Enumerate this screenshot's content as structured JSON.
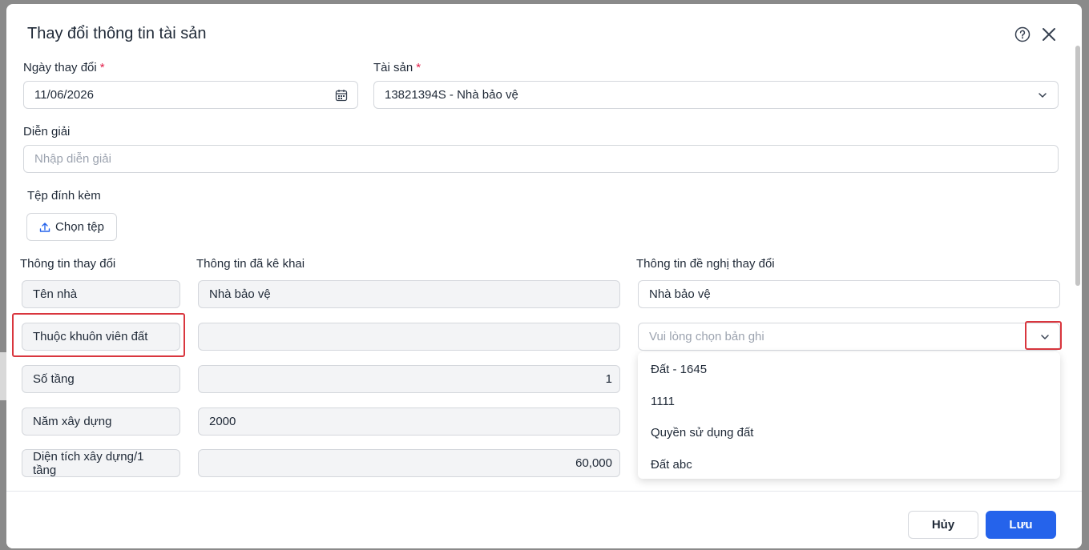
{
  "dialog": {
    "title": "Thay đổi thông tin tài sản"
  },
  "form": {
    "change_date": {
      "label": "Ngày thay đổi",
      "required_mark": "*",
      "value": "11/06/2026"
    },
    "asset": {
      "label": "Tài sản",
      "required_mark": "*",
      "value": "13821394S - Nhà bảo vệ"
    },
    "description": {
      "label": "Diễn giải",
      "placeholder": "Nhập diễn giải"
    },
    "attachment": {
      "label": "Tệp đính kèm",
      "button_label": "Chọn tệp"
    }
  },
  "change_table": {
    "headers": [
      "Thông tin thay đổi",
      "Thông tin đã kê khai",
      "Thông tin đề nghị thay đổi"
    ],
    "rows": [
      {
        "field": "Tên nhà",
        "declared": "Nhà bảo vệ",
        "proposed": "Nhà bảo vệ"
      },
      {
        "field": "Thuộc khuôn viên đất",
        "declared": "",
        "proposed_placeholder": "Vui lòng chọn bản ghi"
      },
      {
        "field": "Số tầng",
        "declared": "1"
      },
      {
        "field": "Năm xây dựng",
        "declared": "2000"
      },
      {
        "field": "Diện tích xây dựng/1 tầng",
        "declared": "60,000"
      }
    ]
  },
  "dropdown": {
    "options": [
      "Đất - 1645",
      "1111",
      "Quyền sử dụng đất",
      "Đất abc"
    ]
  },
  "footer": {
    "cancel_label": "Hủy",
    "save_label": "Lưu"
  },
  "colors": {
    "primary": "#2563eb",
    "highlight": "#d9363e",
    "required": "#e11d48"
  }
}
